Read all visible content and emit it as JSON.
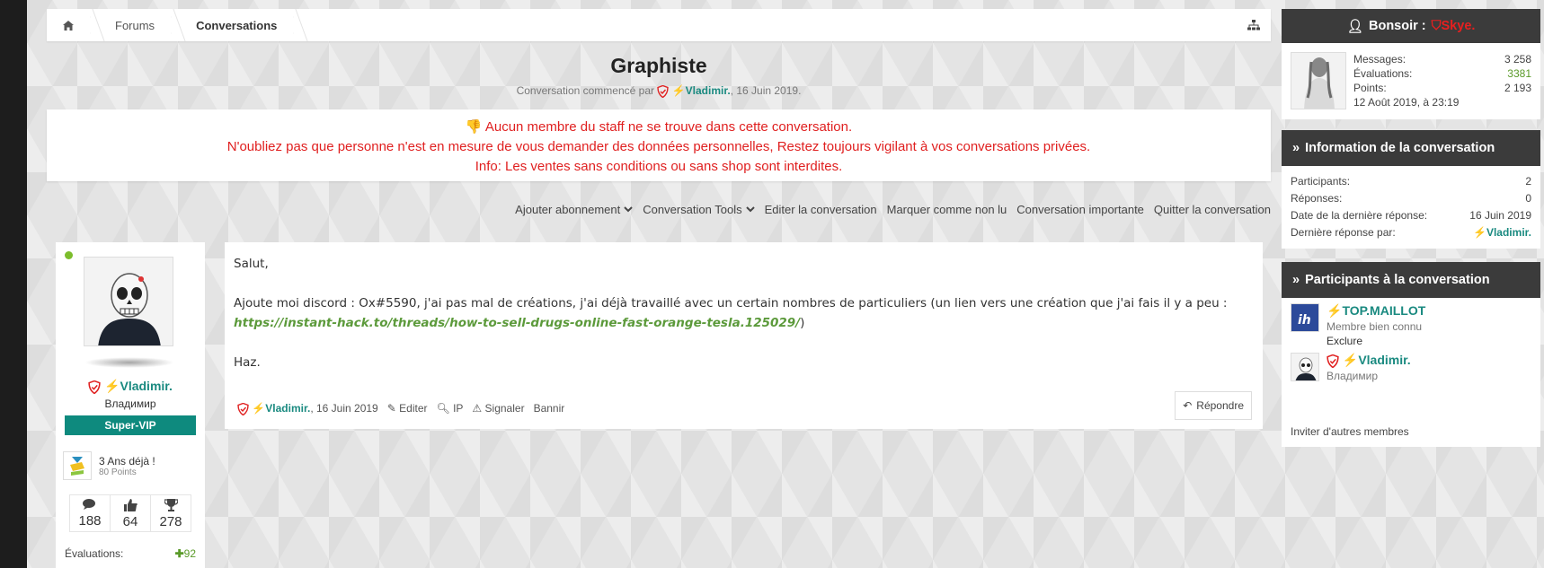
{
  "breadcrumb": {
    "items": [
      {
        "label": "Forums"
      },
      {
        "label": "Conversations"
      }
    ]
  },
  "thread": {
    "title": "Graphiste",
    "started_prefix": "Conversation commencé par",
    "author": "Vladimir.",
    "date": ", 16 Juin 2019."
  },
  "notice": {
    "line1": "Aucun membre du staff ne se trouve dans cette conversation.",
    "line2": "N'oubliez pas que personne n'est en mesure de vous demander des données personnelles, Restez toujours vigilant à vos conversations privées.",
    "line3": "Info: Les ventes sans conditions ou sans shop sont interdites."
  },
  "actions": {
    "subscribe": "Ajouter abonnement",
    "tools": "Conversation Tools",
    "edit": "Editer la conversation",
    "unread": "Marquer comme non lu",
    "important": "Conversation importante",
    "leave": "Quitter la conversation"
  },
  "poster": {
    "name": "Vladimir.",
    "subtitle": "Владимир",
    "badge": "Super-VIP",
    "award_title": "3 Ans déjà !",
    "award_points": "80 Points",
    "stats": [
      "188",
      "64",
      "278"
    ],
    "evals_label": "Évaluations:",
    "evals_value": "92"
  },
  "post": {
    "greeting": "Salut,",
    "body_text": "Ajoute moi discord : Ox#5590, j'ai pas mal de créations, j'ai déjà travaillé avec un certain nombres de particuliers (un lien vers une création que j'ai fais il y a peu : ",
    "link": "https://instant-hack.to/threads/how-to-sell-drugs-online-fast-orange-tesla.125029/",
    "body_end": ")",
    "signoff": "Haz.",
    "footer_author": "Vladimir.",
    "footer_date": ", 16 Juin 2019",
    "edit": "Editer",
    "ip": "IP",
    "report": "Signaler",
    "ban": "Bannir",
    "reply": "Répondre"
  },
  "sidebar": {
    "greeting": "Bonsoir :",
    "username": "Skye.",
    "messages_label": "Messages:",
    "messages_value": "3 258",
    "evals_label": "Évaluations:",
    "evals_value": "3381",
    "points_label": "Points:",
    "points_value": "2 193",
    "joined": "12 Août 2019, à 23:19",
    "info_title": "Information de la conversation",
    "info": [
      {
        "label": "Participants:",
        "value": "2"
      },
      {
        "label": "Réponses:",
        "value": "0"
      },
      {
        "label": "Date de la dernière réponse:",
        "value": "16 Juin 2019"
      },
      {
        "label": "Dernière réponse par:",
        "value": "Vladimir."
      }
    ],
    "participants_title": "Participants à la conversation",
    "participants": [
      {
        "name": "TOP.MAILLOT",
        "sub": "Membre bien connu",
        "extra": "Exclure"
      },
      {
        "name": "Vladimir.",
        "sub": "Владимир"
      }
    ],
    "invite": "Inviter d'autres membres"
  },
  "colors": {
    "accent": "#1a8a80",
    "alert": "#e02020",
    "header": "#3b3b3b",
    "green": "#5a9a29"
  }
}
